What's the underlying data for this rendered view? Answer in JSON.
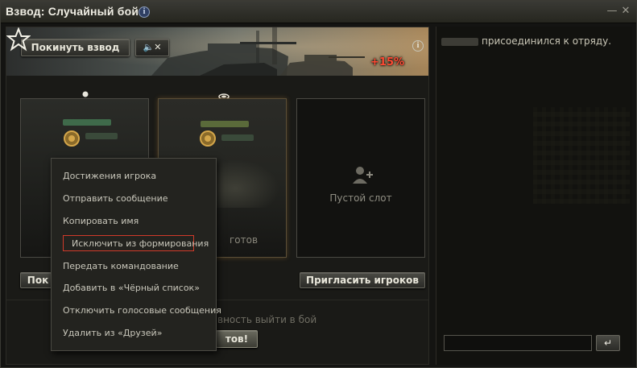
{
  "window": {
    "title": "Взвод: Случайный бой",
    "info_icon": "i",
    "minimize_icon": "—",
    "close_icon": "✕"
  },
  "banner": {
    "leave_label": "Покинуть взвод",
    "mute_icon": "🔈✕",
    "bonus_label": "+15%",
    "info_icon": "i"
  },
  "slots": [
    {
      "status": "",
      "role": "commander"
    },
    {
      "status": "готов",
      "role": "member"
    },
    {
      "empty_label": "Пустой слот"
    }
  ],
  "buttons": {
    "slot1_label": "Пок",
    "invite_label": "Пригласить игроков",
    "ready_label": "тов!"
  },
  "hint": "вность выйти в бой",
  "context_menu": {
    "items": [
      "Достижения игрока",
      "Отправить сообщение",
      "Копировать имя",
      "Исключить из формирования",
      "Передать командование",
      "Добавить в «Чёрный список»",
      "Отключить голосовые сообщения",
      "Удалить из «Друзей»"
    ],
    "highlighted_index": 3
  },
  "chat": {
    "message": "присоединился к отряду.",
    "input_value": "",
    "send_icon": "↵"
  },
  "colors": {
    "accent_red": "#d03a2a",
    "bonus_red": "#ff4a33",
    "background": "#141412"
  }
}
